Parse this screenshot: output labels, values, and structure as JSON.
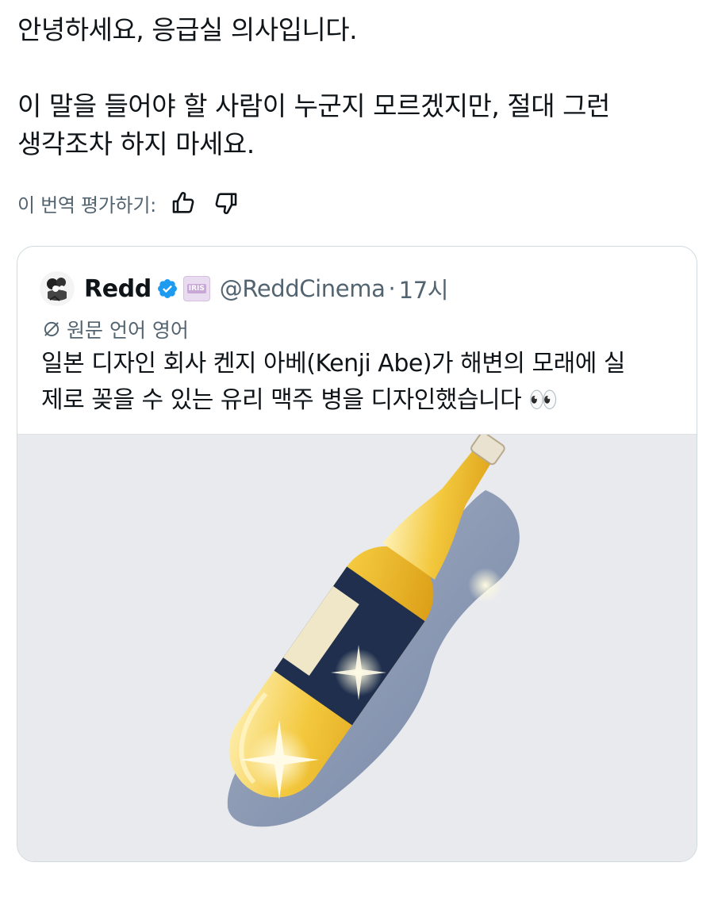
{
  "tweet": {
    "line1": "안녕하세요, 응급실 의사입니다.",
    "line2": "이 말을 들어야 할 사람이 누군지 모르겠지만, 절대 그런",
    "line3": "생각조차 하지 마세요."
  },
  "translation": {
    "label": "이 번역 평가하기:",
    "thumbs_up_icon": "thumbs-up-icon",
    "thumbs_down_icon": "thumbs-down-icon"
  },
  "quote": {
    "display_name": "Redd",
    "affiliation_badge": "IRIS",
    "handle": "@ReddCinema",
    "separator": "·",
    "time": "17시",
    "original_language": "원문 언어 영어",
    "text_line1": "일본 디자인 회사 켄지 아베(Kenji Abe)가 해변의 모래에 실",
    "text_line2": "제로 꽂을 수 있는 유리 맥주 병을 디자인했습니다 👀"
  },
  "colors": {
    "text_primary": "#0f1419",
    "text_secondary": "#536471",
    "border": "#cfd9de",
    "verified": "#1d9bf0",
    "media_bg": "#e9eaee"
  }
}
